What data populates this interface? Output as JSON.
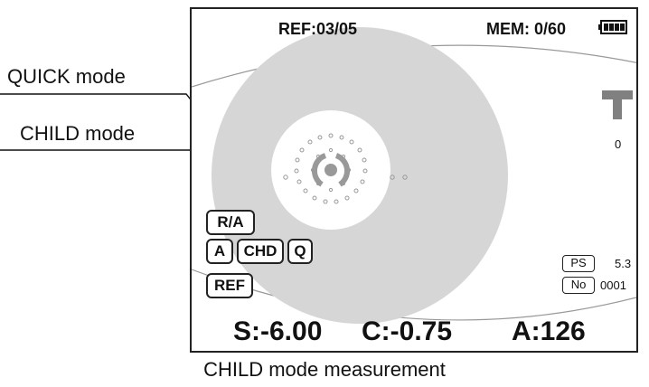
{
  "header": {
    "ref_label": "REF:03/05",
    "mem_label": "MEM: 0/60",
    "battery": "full"
  },
  "callouts": {
    "quick_mode": "QUICK mode",
    "child_mode": "CHILD mode"
  },
  "mode_buttons": {
    "ra": "R/A",
    "a": "A",
    "chd": "CHD",
    "q": "Q",
    "ref": "REF"
  },
  "tonometer": {
    "icon": "t-icon",
    "value": "0"
  },
  "right_info": {
    "ps_label": "PS",
    "ps_value": "5.3",
    "no_label": "No",
    "no_value": "0001"
  },
  "measurement": {
    "s": "S:-6.00",
    "c": "C:-0.75",
    "a": "A:126"
  },
  "caption": "CHILD mode measurement",
  "colors": {
    "pupil_gray": "#d6d6d6",
    "border": "#222222",
    "tonometer_gray": "#808080"
  }
}
